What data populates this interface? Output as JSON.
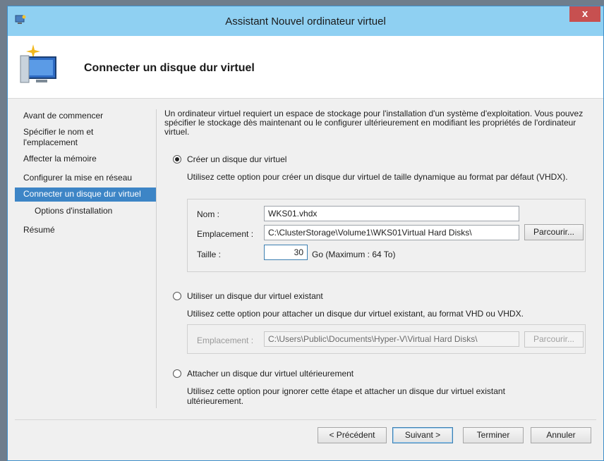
{
  "window": {
    "title": "Assistant Nouvel ordinateur virtuel",
    "close_glyph": "x"
  },
  "header": {
    "title": "Connecter un disque dur virtuel"
  },
  "nav": {
    "items": [
      {
        "label": "Avant de commencer"
      },
      {
        "label": "Spécifier le nom et l'emplacement"
      },
      {
        "label": "Affecter la mémoire"
      },
      {
        "label": "Configurer la mise en réseau"
      },
      {
        "label": "Connecter un disque dur virtuel",
        "selected": true
      },
      {
        "label": "Options d'installation"
      },
      {
        "label": "Résumé"
      }
    ]
  },
  "content": {
    "intro": "Un ordinateur virtuel requiert un espace de stockage pour l'installation d'un système d'exploitation. Vous pouvez spécifier le stockage dès maintenant ou le configurer ultérieurement en modifiant les propriétés de l'ordinateur virtuel.",
    "option_create": {
      "label": "Créer un disque dur virtuel",
      "selected": true,
      "description": "Utilisez cette option pour créer un disque dur virtuel de taille dynamique au format par défaut (VHDX).",
      "name_label": "Nom :",
      "name_value": "WKS01.vhdx",
      "location_label": "Emplacement :",
      "location_value": "C:\\ClusterStorage\\Volume1\\WKS01Virtual Hard Disks\\",
      "browse_label": "Parcourir...",
      "size_label": "Taille :",
      "size_value": "30",
      "size_unit": "Go (Maximum : 64 To)"
    },
    "option_existing": {
      "label": "Utiliser un disque dur virtuel existant",
      "selected": false,
      "description": "Utilisez cette option pour attacher un disque dur virtuel existant, au format VHD ou VHDX.",
      "location_label": "Emplacement :",
      "location_value": "C:\\Users\\Public\\Documents\\Hyper-V\\Virtual Hard Disks\\",
      "browse_label": "Parcourir..."
    },
    "option_later": {
      "label": "Attacher un disque dur virtuel ultérieurement",
      "selected": false,
      "description": "Utilisez cette option pour ignorer cette étape et attacher un disque dur virtuel existant ultérieurement."
    }
  },
  "footer": {
    "previous_label": "< Précédent",
    "next_label": "Suivant >",
    "finish_label": "Terminer",
    "cancel_label": "Annuler"
  },
  "colors": {
    "titlebar": "#8fd0f2",
    "selection": "#3d85c6",
    "close": "#c75050"
  }
}
